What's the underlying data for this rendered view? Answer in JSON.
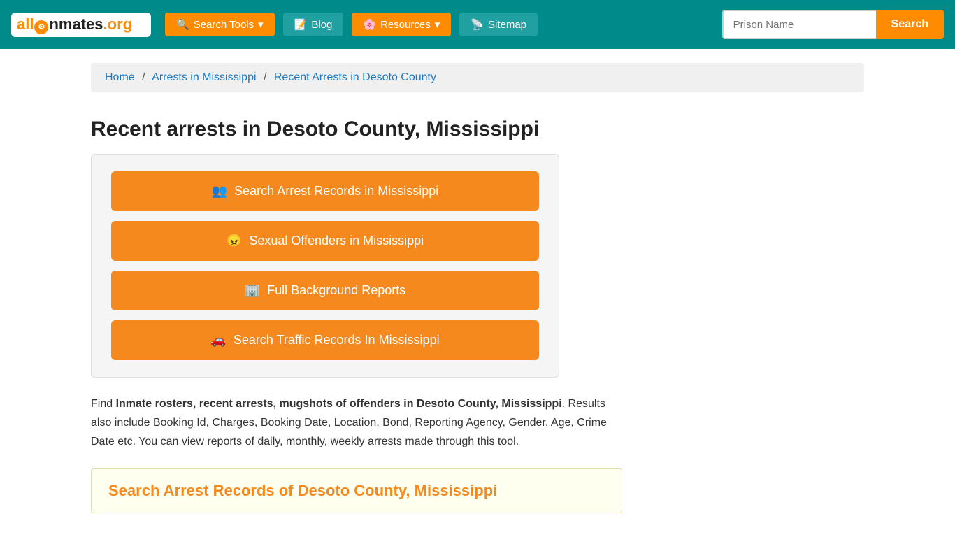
{
  "header": {
    "logo": {
      "part1": "all",
      "part2": "Inmates",
      "part3": ".org"
    },
    "nav": [
      {
        "id": "search-tools",
        "label": "Search Tools",
        "icon": "🔍",
        "dropdown": true,
        "style": "orange"
      },
      {
        "id": "blog",
        "label": "Blog",
        "icon": "📝",
        "dropdown": false,
        "style": "teal"
      },
      {
        "id": "resources",
        "label": "Resources",
        "icon": "🌸",
        "dropdown": true,
        "style": "orange"
      },
      {
        "id": "sitemap",
        "label": "Sitemap",
        "icon": "📡",
        "dropdown": false,
        "style": "teal"
      }
    ],
    "search_placeholder": "Prison Name",
    "search_button": "Search"
  },
  "breadcrumb": {
    "items": [
      {
        "label": "Home",
        "href": "#"
      },
      {
        "label": "Arrests in Mississippi",
        "href": "#"
      },
      {
        "label": "Recent Arrests in Desoto County",
        "href": "#"
      }
    ]
  },
  "page": {
    "title": "Recent arrests in Desoto County, Mississippi",
    "buttons": [
      {
        "id": "arrest-records",
        "icon": "👥",
        "label": "Search Arrest Records in Mississippi"
      },
      {
        "id": "sexual-offenders",
        "icon": "😠",
        "label": "Sexual Offenders in Mississippi"
      },
      {
        "id": "background-reports",
        "icon": "🏢",
        "label": "Full Background Reports"
      },
      {
        "id": "traffic-records",
        "icon": "🚗",
        "label": "Search Traffic Records In Mississippi"
      }
    ],
    "description": {
      "intro": "Find ",
      "bold1": "Inmate rosters, recent arrests, mugshots of offenders in Desoto County, Mississippi",
      "rest": ". Results also include Booking Id, Charges, Booking Date, Location, Bond, Reporting Agency, Gender, Age, Crime Date etc. You can view reports of daily, monthly, weekly arrests made through this tool."
    },
    "search_section": {
      "title": "Search Arrest Records of Desoto County, Mississippi"
    }
  }
}
